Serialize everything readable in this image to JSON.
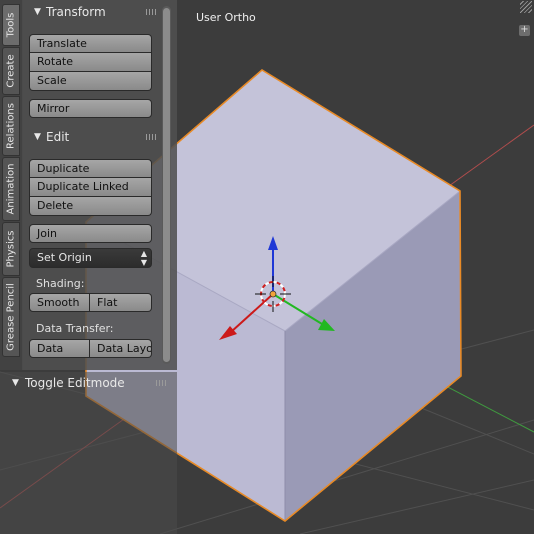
{
  "viewport": {
    "view_label": "User Ortho",
    "add_region_symbol": "+",
    "colors": {
      "background": "#3c3c3c",
      "cube_top": "#c4c3d9",
      "cube_left": "#bbbad3",
      "cube_right": "#9a9ab6",
      "selection_outline": "#e88a26",
      "grid_x_axis": "#b14d4d",
      "grid_y_axis": "#3f9a3f"
    },
    "icons": [
      "3d-cursor-icon",
      "gizmo-x-arrow-icon",
      "gizmo-y-arrow-icon",
      "gizmo-z-arrow-icon",
      "origin-dot-icon"
    ]
  },
  "tabs": [
    {
      "label": "Tools",
      "active": true
    },
    {
      "label": "Create",
      "active": false
    },
    {
      "label": "Relations",
      "active": false
    },
    {
      "label": "Animation",
      "active": false
    },
    {
      "label": "Physics",
      "active": false
    },
    {
      "label": "Grease Pencil",
      "active": false
    }
  ],
  "tool_shelf": {
    "transform": {
      "header": "Transform",
      "translate": "Translate",
      "rotate": "Rotate",
      "scale": "Scale",
      "mirror": "Mirror"
    },
    "edit": {
      "header": "Edit",
      "duplicate": "Duplicate",
      "duplicate_linked": "Duplicate Linked",
      "delete": "Delete",
      "join": "Join",
      "set_origin": "Set Origin",
      "shading_label": "Shading:",
      "smooth": "Smooth",
      "flat": "Flat",
      "data_transfer_label": "Data Transfer:",
      "data": "Data",
      "data_layout": "Data Layo"
    }
  },
  "operator_panel": {
    "header": "Toggle Editmode"
  }
}
